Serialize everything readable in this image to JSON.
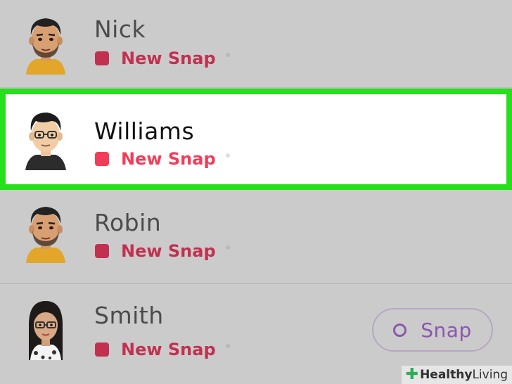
{
  "contacts": [
    {
      "name": "Nick",
      "status": "New Snap",
      "highlighted": false,
      "avatar_icon": "bitmoji-man-beard-icon"
    },
    {
      "name": "Williams",
      "status": "New Snap",
      "highlighted": true,
      "avatar_icon": "bitmoji-man-glasses-icon"
    },
    {
      "name": "Robin",
      "status": "New Snap",
      "highlighted": false,
      "avatar_icon": "bitmoji-man-beard-icon"
    },
    {
      "name": "Smith",
      "status": "New Snap",
      "highlighted": false,
      "avatar_icon": "bitmoji-woman-glasses-icon",
      "action_label": "Snap"
    }
  ],
  "watermark": {
    "brand_bold": "Healthy",
    "brand_light": "Living"
  },
  "colors": {
    "background": "#cbcbcb",
    "highlight_border": "#25e01b",
    "new_snap_red": "#c23050",
    "snap_purple": "#8a57ae"
  }
}
